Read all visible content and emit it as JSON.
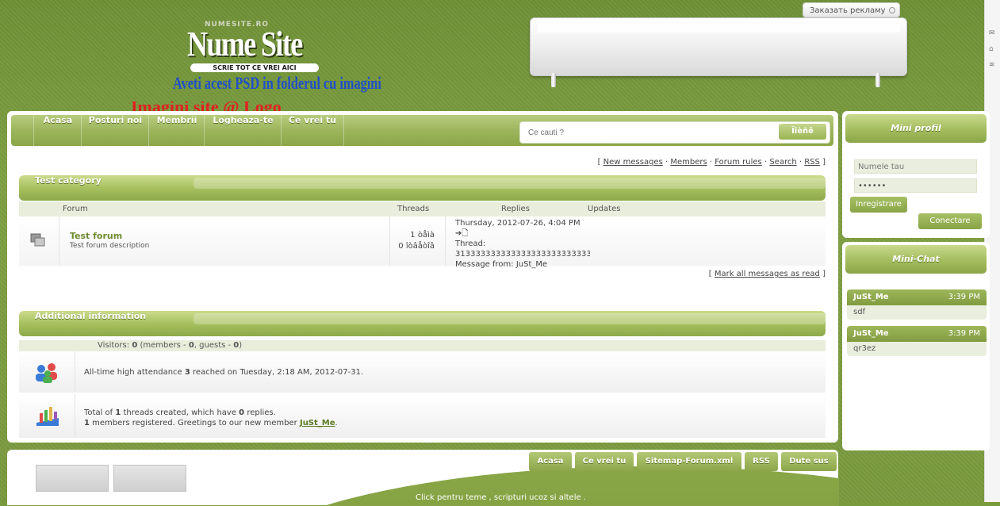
{
  "header": {
    "logo_small": "NUMESITE.RO",
    "logo_text": "Nume Site",
    "logo_tagline": "SCRIE TOT CE VREI AICI",
    "psd_note": "Aveti acest PSD in folderul cu imagini",
    "red_note": "Imagini site @ Logo",
    "ad_button": "Заказать рекламу"
  },
  "nav": {
    "items": [
      "Acasa",
      "Posturi noi",
      "Membrii",
      "Logheaza-te",
      "Ce vrei tu"
    ],
    "search_placeholder": "Ce cauti ?",
    "search_button": "Ïîèñê"
  },
  "toplinks": {
    "open": "[",
    "close": "]",
    "sep": "·",
    "items": [
      "New messages",
      "Members",
      "Forum rules",
      "Search",
      "RSS"
    ]
  },
  "category": {
    "title": "Test category",
    "columns": [
      "Forum",
      "Threads",
      "Replies",
      "Updates"
    ],
    "forum": {
      "name": "Test forum",
      "description": "Test forum description",
      "threads": "1 òåìà",
      "replies": "0 îòâåòîâ",
      "last_date": "Thursday, 2012-07-26, 4:04 PM",
      "last_thread_label": "Thread:",
      "last_thread": "3133333333333333333333333333",
      "last_from": "Message from: JuSt_Me"
    },
    "mark_all": "Mark all messages as read"
  },
  "additional": {
    "title": "Additional information",
    "visitors": {
      "label": "Visitors:",
      "total": "0",
      "members_label": "members -",
      "members": "0",
      "guests_label": "guests -",
      "guests": "0"
    },
    "attendance": {
      "pre": "All-time high attendance",
      "count": "3",
      "post": "reached on Tuesday, 2:18 AM, 2012-07-31."
    },
    "stats": {
      "total_pre": "Total of",
      "threads": "1",
      "threads_mid": "threads created, which have",
      "replies": "0",
      "replies_post": "replies.",
      "members": "1",
      "members_mid": "members registered. Greetings to our new member",
      "new_member": "JuSt_Me"
    }
  },
  "sidebar": {
    "profile_title": "Mini profil",
    "username_placeholder": "Numele tau",
    "password_value": "••••••",
    "register_button": "Inregistrare",
    "login_button": "Conectare",
    "chat_title": "Mini-Chat",
    "chat": [
      {
        "name": "JuSt_Me",
        "time": "3:39 PM",
        "text": "sdf"
      },
      {
        "name": "JuSt_Me",
        "time": "3:39 PM",
        "text": "qr3ez"
      }
    ]
  },
  "footer": {
    "buttons": [
      "Acasa",
      "Ce vrei tu",
      "Sitemap-Forum.xml",
      "RSS",
      "Dute sus"
    ],
    "credit": "Click pentru teme , scripturi ucoz si altele ."
  },
  "colors": {
    "accent": "#9ab454",
    "brand_blue": "#1f4fc9",
    "red": "#e02020"
  }
}
